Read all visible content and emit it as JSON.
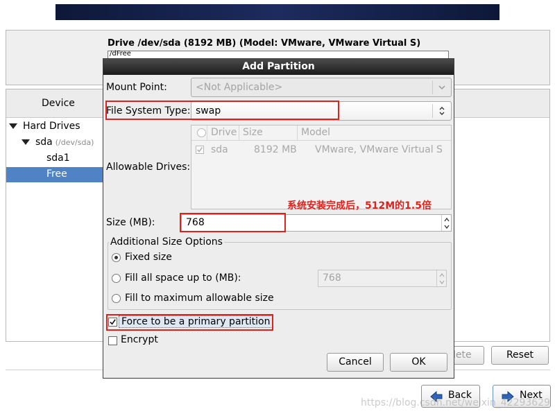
{
  "background": {
    "drive_title": "Drive /dev/sda (8192 MB) (Model: VMware, VMware Virtual S)",
    "drive_bar_label": "/dFree",
    "device_header": "Device",
    "tree": {
      "hard_drives": "Hard Drives",
      "sda": "sda",
      "sda_path": "(/dev/sda)",
      "sda1": "sda1",
      "free": "Free"
    },
    "delete_label": "lete",
    "reset_label": "Reset",
    "back_label": "Back",
    "next_label": "Next",
    "watermark": "https://blog.csdn.net/weixin_42293629"
  },
  "dialog": {
    "title": "Add Partition",
    "mount_point_label": "Mount Point:",
    "mount_point_value": "<Not Applicable>",
    "fs_type_label": "File System Type:",
    "fs_type_value": "swap",
    "allowable_drives_label": "Allowable Drives:",
    "drives_columns": [
      "Drive",
      "Size",
      "Model"
    ],
    "drives_rows": [
      {
        "checked": true,
        "drive": "sda",
        "size": "8192 MB",
        "model": "VMware, VMware Virtual S"
      }
    ],
    "annotation": "系统安装完成后，512M的1.5倍",
    "size_label": "Size (MB):",
    "size_value": "768",
    "size_options_legend": "Additional Size Options",
    "options": [
      {
        "label": "Fixed size",
        "selected": true
      },
      {
        "label": "Fill all space up to (MB):",
        "selected": false
      },
      {
        "label": "Fill to maximum allowable size",
        "selected": false
      }
    ],
    "fill_up_to_value": "768",
    "primary_label": "Force to be a primary partition",
    "primary_checked": true,
    "encrypt_label": "Encrypt",
    "encrypt_checked": false,
    "cancel_label": "Cancel",
    "ok_label": "OK"
  },
  "colors": {
    "highlight": "#4f83c5",
    "annotation_red": "#e0201a"
  }
}
